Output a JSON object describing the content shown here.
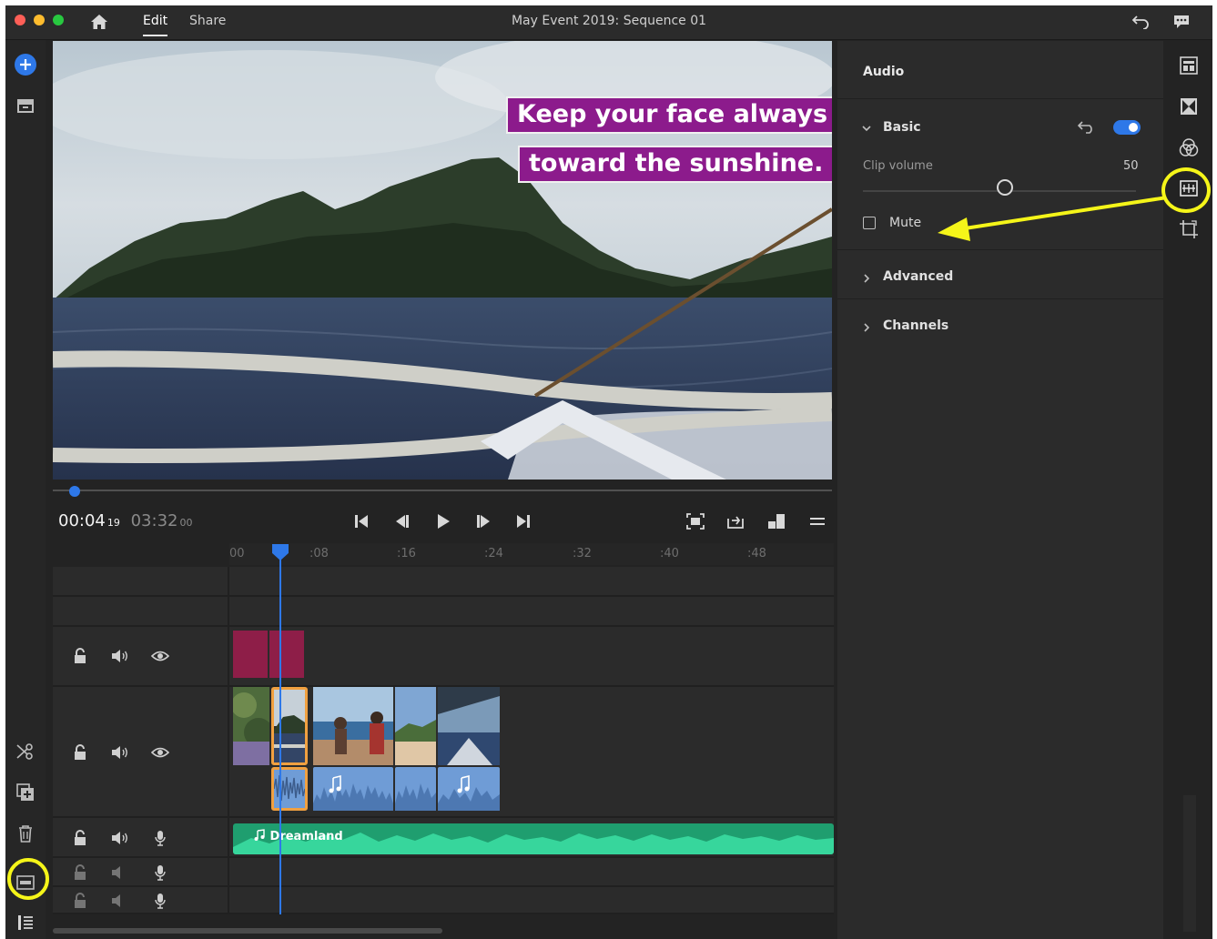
{
  "titlebar": {
    "tabs": [
      "Edit",
      "Share"
    ],
    "title": "May Event 2019: Sequence 01"
  },
  "monitor": {
    "caption_line1": "Keep your face always",
    "caption_line2": "toward the sunshine."
  },
  "transport": {
    "current_time": "00:04",
    "current_frames": "19",
    "duration": "03:32",
    "duration_frames": "00"
  },
  "ruler": {
    "ticks": [
      "00",
      ":08",
      ":16",
      ":24",
      ":32",
      ":40",
      ":48"
    ]
  },
  "audio_track": {
    "clip_name": "Dreamland"
  },
  "panel": {
    "title": "Audio",
    "basic_label": "Basic",
    "clip_volume_label": "Clip volume",
    "clip_volume_value": "50",
    "clip_volume_level": 0.5,
    "mute_label": "Mute",
    "mute_checked": false,
    "advanced_label": "Advanced",
    "channels_label": "Channels"
  },
  "colors": {
    "accent": "#2e78e8",
    "caption_bg": "#8c1b8c",
    "audio_clip": "#27c58d",
    "title_clip": "#8e1e48",
    "video_audio": "#6f9cd6",
    "highlight": "#f5f519",
    "selection": "#f0a040"
  }
}
